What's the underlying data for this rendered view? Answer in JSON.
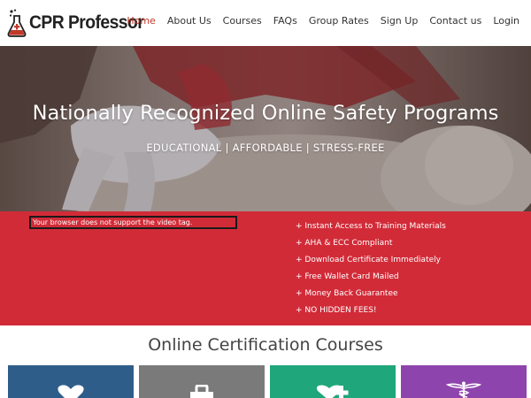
{
  "brand": {
    "name": "CPR Professor",
    "logo_icon": "flask-icon",
    "logo_color": "#c0392b"
  },
  "nav": {
    "items": [
      {
        "label": "Home",
        "active": true
      },
      {
        "label": "About Us",
        "active": false
      },
      {
        "label": "Courses",
        "active": false
      },
      {
        "label": "FAQs",
        "active": false
      },
      {
        "label": "Group Rates",
        "active": false
      },
      {
        "label": "Sign Up",
        "active": false
      },
      {
        "label": "Contact us",
        "active": false
      },
      {
        "label": "Login",
        "active": false
      }
    ],
    "active_color": "#c0392b"
  },
  "hero": {
    "title": "Nationally Recognized Online Safety Programs",
    "subtitle": "EDUCATIONAL | AFFORDABLE | STRESS-FREE"
  },
  "band": {
    "background": "#d22b38",
    "video_fallback": "Your browser does not support the video tag.",
    "features": [
      "+ Instant Access to Training Materials",
      "+ AHA & ECC Compliant",
      "+ Download Certificate Immediately",
      "+ Free Wallet Card Mailed",
      "+ Money Back Guarantee",
      "+ NO HIDDEN FEES!"
    ]
  },
  "courses": {
    "title": "Online Certification Courses",
    "cards": [
      {
        "icon": "heart-icon",
        "color": "#2f5d8a"
      },
      {
        "icon": "first-aid-kit-icon",
        "color": "#7a7a7a"
      },
      {
        "icon": "heart-plus-icon",
        "color": "#1fa67a"
      },
      {
        "icon": "caduceus-icon",
        "color": "#8e44ad"
      }
    ]
  }
}
